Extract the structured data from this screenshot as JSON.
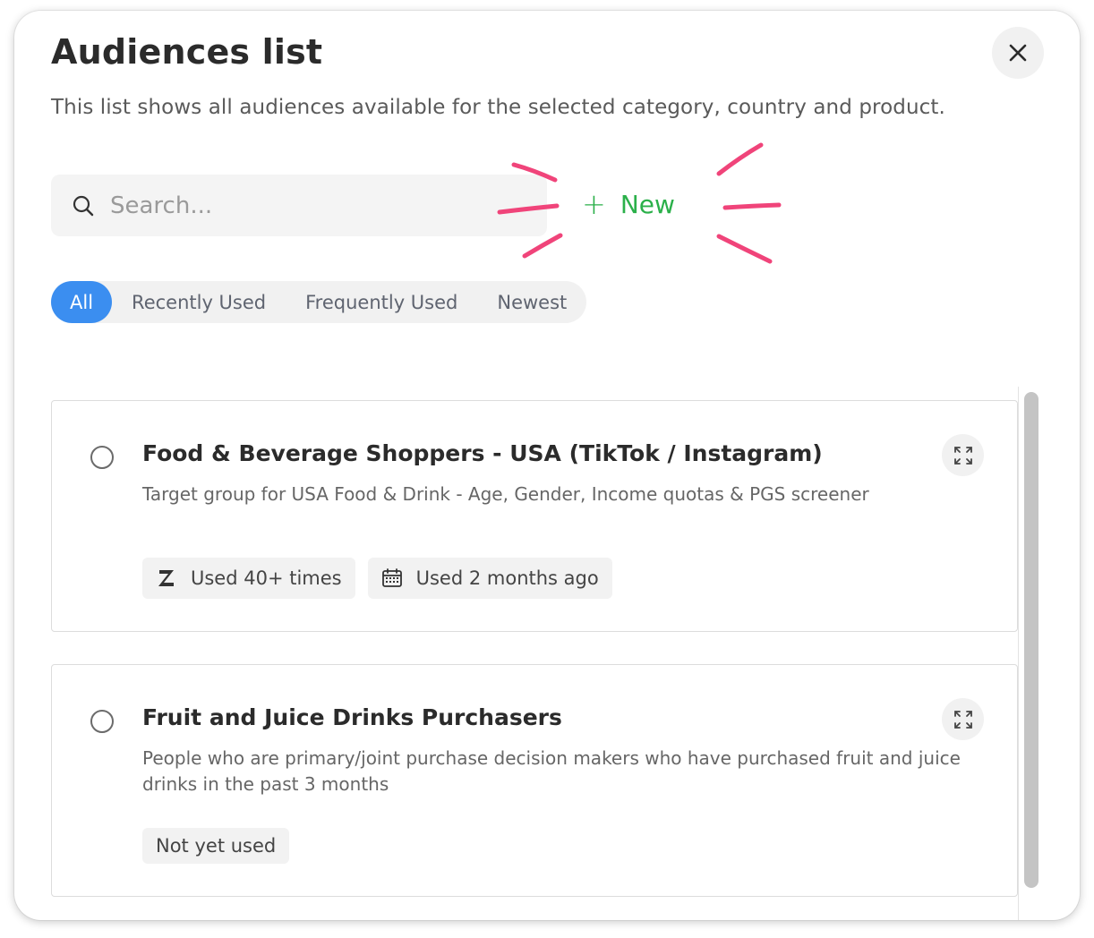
{
  "header": {
    "title": "Audiences list",
    "subtitle": "This list shows all audiences available for the selected category, country and product."
  },
  "search": {
    "placeholder": "Search..."
  },
  "new_button": {
    "icon": "+",
    "label": "New",
    "color": "#2bb04a"
  },
  "highlight_color": "#f0447a",
  "tabs": [
    {
      "label": "All",
      "active": true
    },
    {
      "label": "Recently Used",
      "active": false
    },
    {
      "label": "Frequently Used",
      "active": false
    },
    {
      "label": "Newest",
      "active": false
    }
  ],
  "accent_color": "#3b8ef0",
  "audiences": [
    {
      "name": "Food & Beverage Shoppers - USA (TikTok / Instagram)",
      "description": "Target group for USA Food & Drink - Age, Gender, Income quotas & PGS screener",
      "badges": [
        {
          "icon": "zappi-logo-icon",
          "label": "Used 40+ times"
        },
        {
          "icon": "calendar-icon",
          "label": "Used 2 months ago"
        }
      ]
    },
    {
      "name": "Fruit and Juice Drinks Purchasers",
      "description": "People who are primary/joint purchase decision makers who have purchased fruit and juice drinks in the past 3 months",
      "badges": [
        {
          "icon": "",
          "label": "Not yet used"
        }
      ]
    }
  ]
}
